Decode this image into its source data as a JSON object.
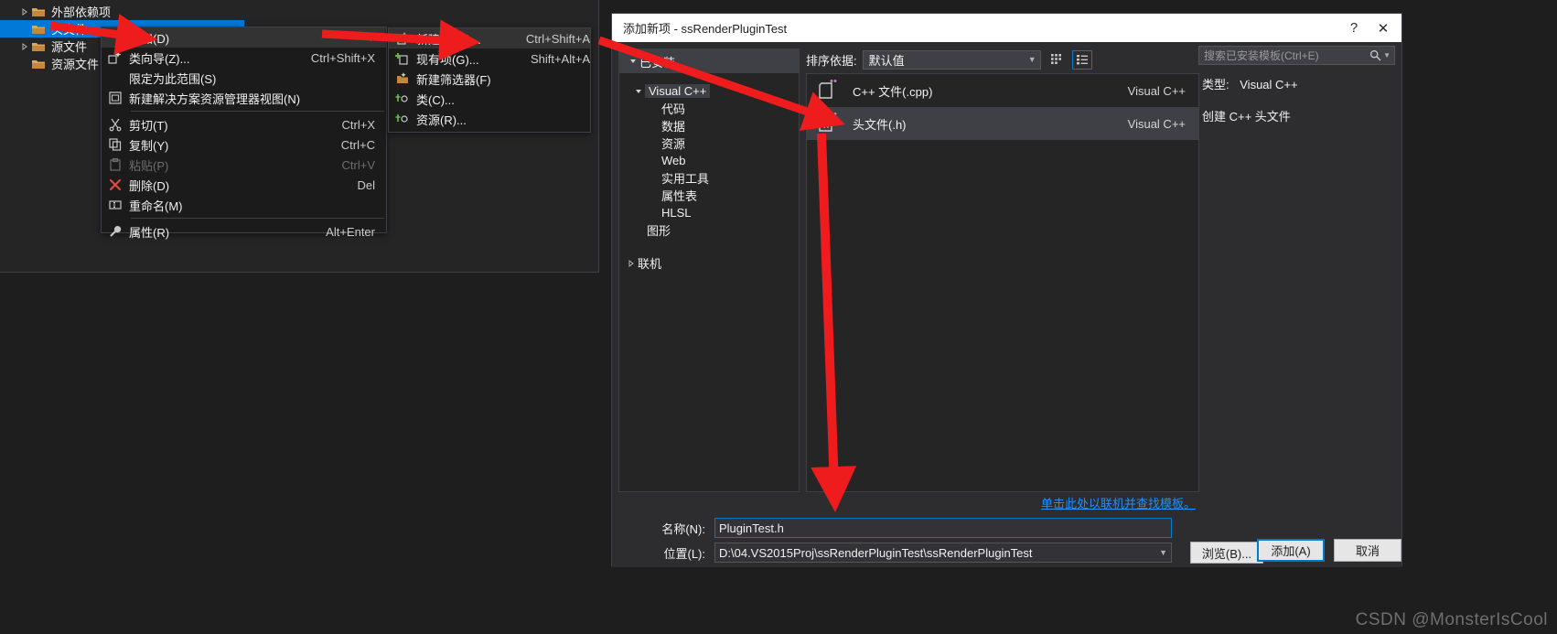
{
  "solution_explorer": {
    "rows": [
      {
        "label": "外部依赖项",
        "expander": "collapsed",
        "selected": false,
        "indent": 22
      },
      {
        "label": "头文件",
        "expander": "none",
        "selected": true,
        "indent": 22
      },
      {
        "label": "源文件",
        "expander": "collapsed",
        "selected": false,
        "indent": 22
      },
      {
        "label": "资源文件",
        "expander": "none",
        "selected": false,
        "indent": 22
      }
    ]
  },
  "context_menu": {
    "items": [
      {
        "label": "添加(D)",
        "shortcut": "",
        "icon": "none",
        "hovered": true,
        "disabled": false,
        "submenu": true
      },
      {
        "label": "类向导(Z)...",
        "shortcut": "Ctrl+Shift+X",
        "icon": "class-wizard-icon",
        "hovered": false,
        "disabled": false
      },
      {
        "label": "限定为此范围(S)",
        "shortcut": "",
        "icon": "none",
        "hovered": false,
        "disabled": false
      },
      {
        "label": "新建解决方案资源管理器视图(N)",
        "shortcut": "",
        "icon": "new-view-icon",
        "hovered": false,
        "disabled": false
      },
      {
        "label": "剪切(T)",
        "shortcut": "Ctrl+X",
        "icon": "scissors-icon",
        "hovered": false,
        "disabled": false
      },
      {
        "label": "复制(Y)",
        "shortcut": "Ctrl+C",
        "icon": "copy-icon",
        "hovered": false,
        "disabled": false
      },
      {
        "label": "粘贴(P)",
        "shortcut": "Ctrl+V",
        "icon": "paste-icon",
        "hovered": false,
        "disabled": true
      },
      {
        "label": "删除(D)",
        "shortcut": "Del",
        "icon": "delete-x-icon",
        "hovered": false,
        "disabled": false
      },
      {
        "label": "重命名(M)",
        "shortcut": "",
        "icon": "rename-icon",
        "hovered": false,
        "disabled": false
      },
      {
        "label": "属性(R)",
        "shortcut": "Alt+Enter",
        "icon": "wrench-icon",
        "hovered": false,
        "disabled": false
      }
    ]
  },
  "submenu": {
    "items": [
      {
        "label": "新建项(W)...",
        "shortcut": "Ctrl+Shift+A",
        "icon": "new-item-icon",
        "hovered": true
      },
      {
        "label": "现有项(G)...",
        "shortcut": "Shift+Alt+A",
        "icon": "existing-item-icon",
        "hovered": false
      },
      {
        "label": "新建筛选器(F)",
        "shortcut": "",
        "icon": "new-filter-icon",
        "hovered": false
      },
      {
        "label": "类(C)...",
        "shortcut": "",
        "icon": "class-icon",
        "hovered": false
      },
      {
        "label": "资源(R)...",
        "shortcut": "",
        "icon": "resource-icon",
        "hovered": false
      }
    ]
  },
  "dialog": {
    "title": "添加新项 - ssRenderPluginTest",
    "help_label": "?",
    "close_label": "✕",
    "installed_group": "已安装",
    "tree": [
      {
        "label": "Visual C++",
        "indent": 14,
        "caret": "expanded",
        "selected": true
      },
      {
        "label": "代码",
        "indent": 46,
        "caret": "none",
        "selected": false
      },
      {
        "label": "数据",
        "indent": 46,
        "caret": "none",
        "selected": false
      },
      {
        "label": "资源",
        "indent": 46,
        "caret": "none",
        "selected": false
      },
      {
        "label": "Web",
        "indent": 46,
        "caret": "none",
        "selected": false
      },
      {
        "label": "实用工具",
        "indent": 46,
        "caret": "none",
        "selected": false
      },
      {
        "label": "属性表",
        "indent": 46,
        "caret": "none",
        "selected": false
      },
      {
        "label": "HLSL",
        "indent": 46,
        "caret": "none",
        "selected": false
      },
      {
        "label": "图形",
        "indent": 30,
        "caret": "none",
        "selected": false
      },
      {
        "label": "联机",
        "indent": 6,
        "caret": "collapsed",
        "selected": false
      }
    ],
    "sort_label": "排序依据:",
    "sort_value": "默认值",
    "view_tiles_icon": "tile-view-icon",
    "view_list_icon": "list-view-icon",
    "search_placeholder": "搜索已安装模板(Ctrl+E)",
    "search_icon": "search-icon",
    "templates": [
      {
        "name": "C++ 文件(.cpp)",
        "language": "Visual C++",
        "icon": "cpp-file-icon",
        "selected": false
      },
      {
        "name": "头文件(.h)",
        "language": "Visual C++",
        "icon": "h-file-icon",
        "selected": true
      }
    ],
    "detail_type_label": "类型:",
    "detail_type_value": "Visual C++",
    "detail_description": "创建 C++ 头文件",
    "online_link": "单击此处以联机并查找模板。",
    "name_label": "名称(N):",
    "name_value": "PluginTest.h",
    "location_label": "位置(L):",
    "location_value": "D:\\04.VS2015Proj\\ssRenderPluginTest\\ssRenderPluginTest",
    "browse_label": "浏览(B)...",
    "add_label": "添加(A)",
    "cancel_label": "取消"
  },
  "watermark": "CSDN @MonsterIsCool",
  "colors": {
    "accent": "#007acc",
    "selection": "#0078d7",
    "panel": "#252526",
    "dialog": "#2d2d30",
    "arrow_red": "#ee1c1c"
  }
}
